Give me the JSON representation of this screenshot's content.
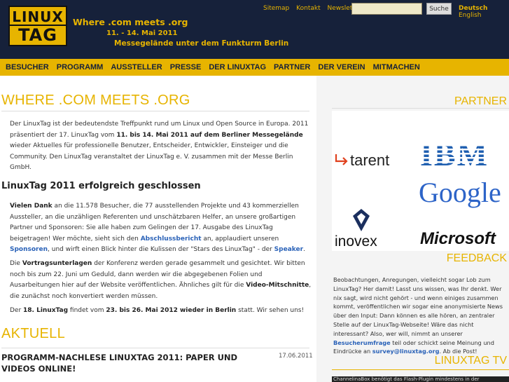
{
  "header": {
    "logo_line1": "LINUX",
    "logo_line2": "TAG",
    "tagline": "Where .com meets .org",
    "dates": "11. - 14. Mai 2011",
    "venue": "Messegelände unter dem Funkturm Berlin",
    "util_links": [
      "Sitemap",
      "Kontakt",
      "Newsletter"
    ],
    "search": {
      "value": "",
      "button_label": "Suche"
    },
    "languages": {
      "active": "Deutsch",
      "other": "English"
    },
    "brand_color": "#e7b400",
    "background_color": "#16213a"
  },
  "nav": {
    "items": [
      "BESUCHER",
      "PROGRAMM",
      "AUSSTELLER",
      "PRESSE",
      "DER LINUXTAG",
      "PARTNER",
      "DER VEREIN",
      "MITMACHEN"
    ]
  },
  "main": {
    "heading": "WHERE .COM MEETS .ORG",
    "intro": {
      "t1": "Der LinuxTag ist der bedeutendste Treffpunkt rund um Linux und Open Source in Europa. 2011 präsentiert der 17. LinuxTag vom ",
      "b1": "11. bis 14. Mai 2011 auf dem Berliner Messegelände",
      "t2": " wieder Aktuelles für professionelle Benutzer, Entscheider, Entwickler, Einsteiger und die Community. Den LinuxTag veranstaltet der LinuxTag e. V. zusammen mit der Messe Berlin GmbH."
    },
    "closed_heading": "LinuxTag 2011 erfolgreich geschlossen",
    "para1": {
      "b1": "Vielen Dank",
      "t1": " an die 11.578 Besucher, die 77 ausstellenden Projekte und 43 kommerziellen Aussteller, an die unzähligen Referenten und unschätzbaren Helfer, an unsere großartigen Partner und Sponsoren: Sie alle haben zum Gelingen der 17. Ausgabe des LinuxTag beigetragen! Wer möchte, sieht sich den ",
      "l1": "Abschlussbericht",
      "t2": " an, applaudiert unseren ",
      "l2": "Sponsoren",
      "t3": ", und wirft einen Blick hinter die Kulissen der \"Stars des LinuxTag\" - der ",
      "l3": "Speaker",
      "t4": "."
    },
    "para2": {
      "t1": "Die ",
      "b1": "Vortragsunterlagen",
      "t2": " der Konferenz werden gerade gesammelt und gesichtet. Wir bitten noch bis zum 22. Juni um Geduld, dann werden wir die abgegebenen Folien und Ausarbeitungen hier auf der Website veröffentlichen. Ähnliches gilt für die ",
      "b2": "Video-Mitschnitte",
      "t3": ", die zunächst noch konvertiert werden müssen."
    },
    "para3": {
      "t1": "Der ",
      "b1": "18. LinuxTag",
      "t2": " findet vom ",
      "b2": "23. bis 26. Mai 2012 wieder in Berlin",
      "t3": " statt. Wir sehen uns!"
    },
    "aktuell_heading": "AKTUELL",
    "news": {
      "title": "PROGRAMM-NACHLESE LINUXTAG 2011: PAPER UND VIDEOS ONLINE!",
      "date": "17.06.2011"
    }
  },
  "sidebar": {
    "partner_heading": "PARTNER",
    "partners": [
      "tarent",
      "IBM",
      "Google",
      "inovex",
      "Microsoft"
    ],
    "feedback_heading": "FEEDBACK",
    "feedback": {
      "t1": "Beobachtungen, Anregungen, vielleicht sogar Lob zum LinuxTag? Her damit! Lasst uns wissen, was Ihr denkt. Wer nix sagt, wird nicht gehört - und wenn einiges zusammen kommt, veröffentlichen wir sogar eine anonymisierte News über den Input: Dann können es alle hören, an zentraler Stelle auf der LinuxTag-Webseite! Wäre das nicht interessant? Also, wer will, nimmt an unserer ",
      "l1": "Besucherumfrage",
      "t2": " teil oder schickt seine Meinung und Eindrücke an ",
      "l2": "survey@linuxtag.org",
      "t3": ". Ab die Post!"
    },
    "tv_heading": "LINUXTAG TV",
    "tv_notice": "ChannelinaBox benötigt das Flash-Plugin mindestens in der"
  }
}
